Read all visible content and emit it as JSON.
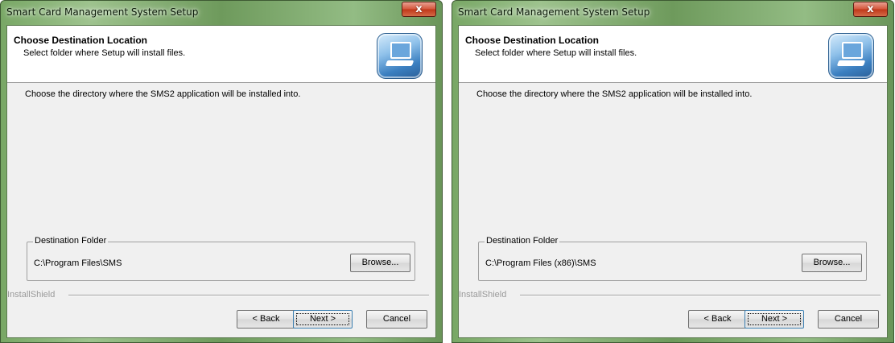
{
  "windows": [
    {
      "title": "Smart Card Management System Setup",
      "close_label": "x",
      "header": {
        "title": "Choose Destination Location",
        "subtitle": "Select folder where Setup will install files.",
        "icon": "setup-computer-icon"
      },
      "instruction": "Choose the directory where the SMS2 application will be installed into.",
      "destination": {
        "label": "Destination Folder",
        "path": "C:\\Program Files\\SMS",
        "browse": "Browse..."
      },
      "brand": "InstallShield",
      "buttons": {
        "back": "< Back",
        "next": "Next >",
        "cancel": "Cancel"
      }
    },
    {
      "title": "Smart Card Management System Setup",
      "close_label": "x",
      "header": {
        "title": "Choose Destination Location",
        "subtitle": "Select folder where Setup will install files.",
        "icon": "setup-computer-icon"
      },
      "instruction": "Choose the directory where the SMS2 application will be installed into.",
      "destination": {
        "label": "Destination Folder",
        "path": "C:\\Program Files (x86)\\SMS",
        "browse": "Browse..."
      },
      "brand": "InstallShield",
      "buttons": {
        "back": "< Back",
        "next": "Next >",
        "cancel": "Cancel"
      }
    }
  ],
  "colors": {
    "frame": "#8cb87a",
    "client_bg": "#f0f0f0",
    "close_button": "#c9462c"
  }
}
